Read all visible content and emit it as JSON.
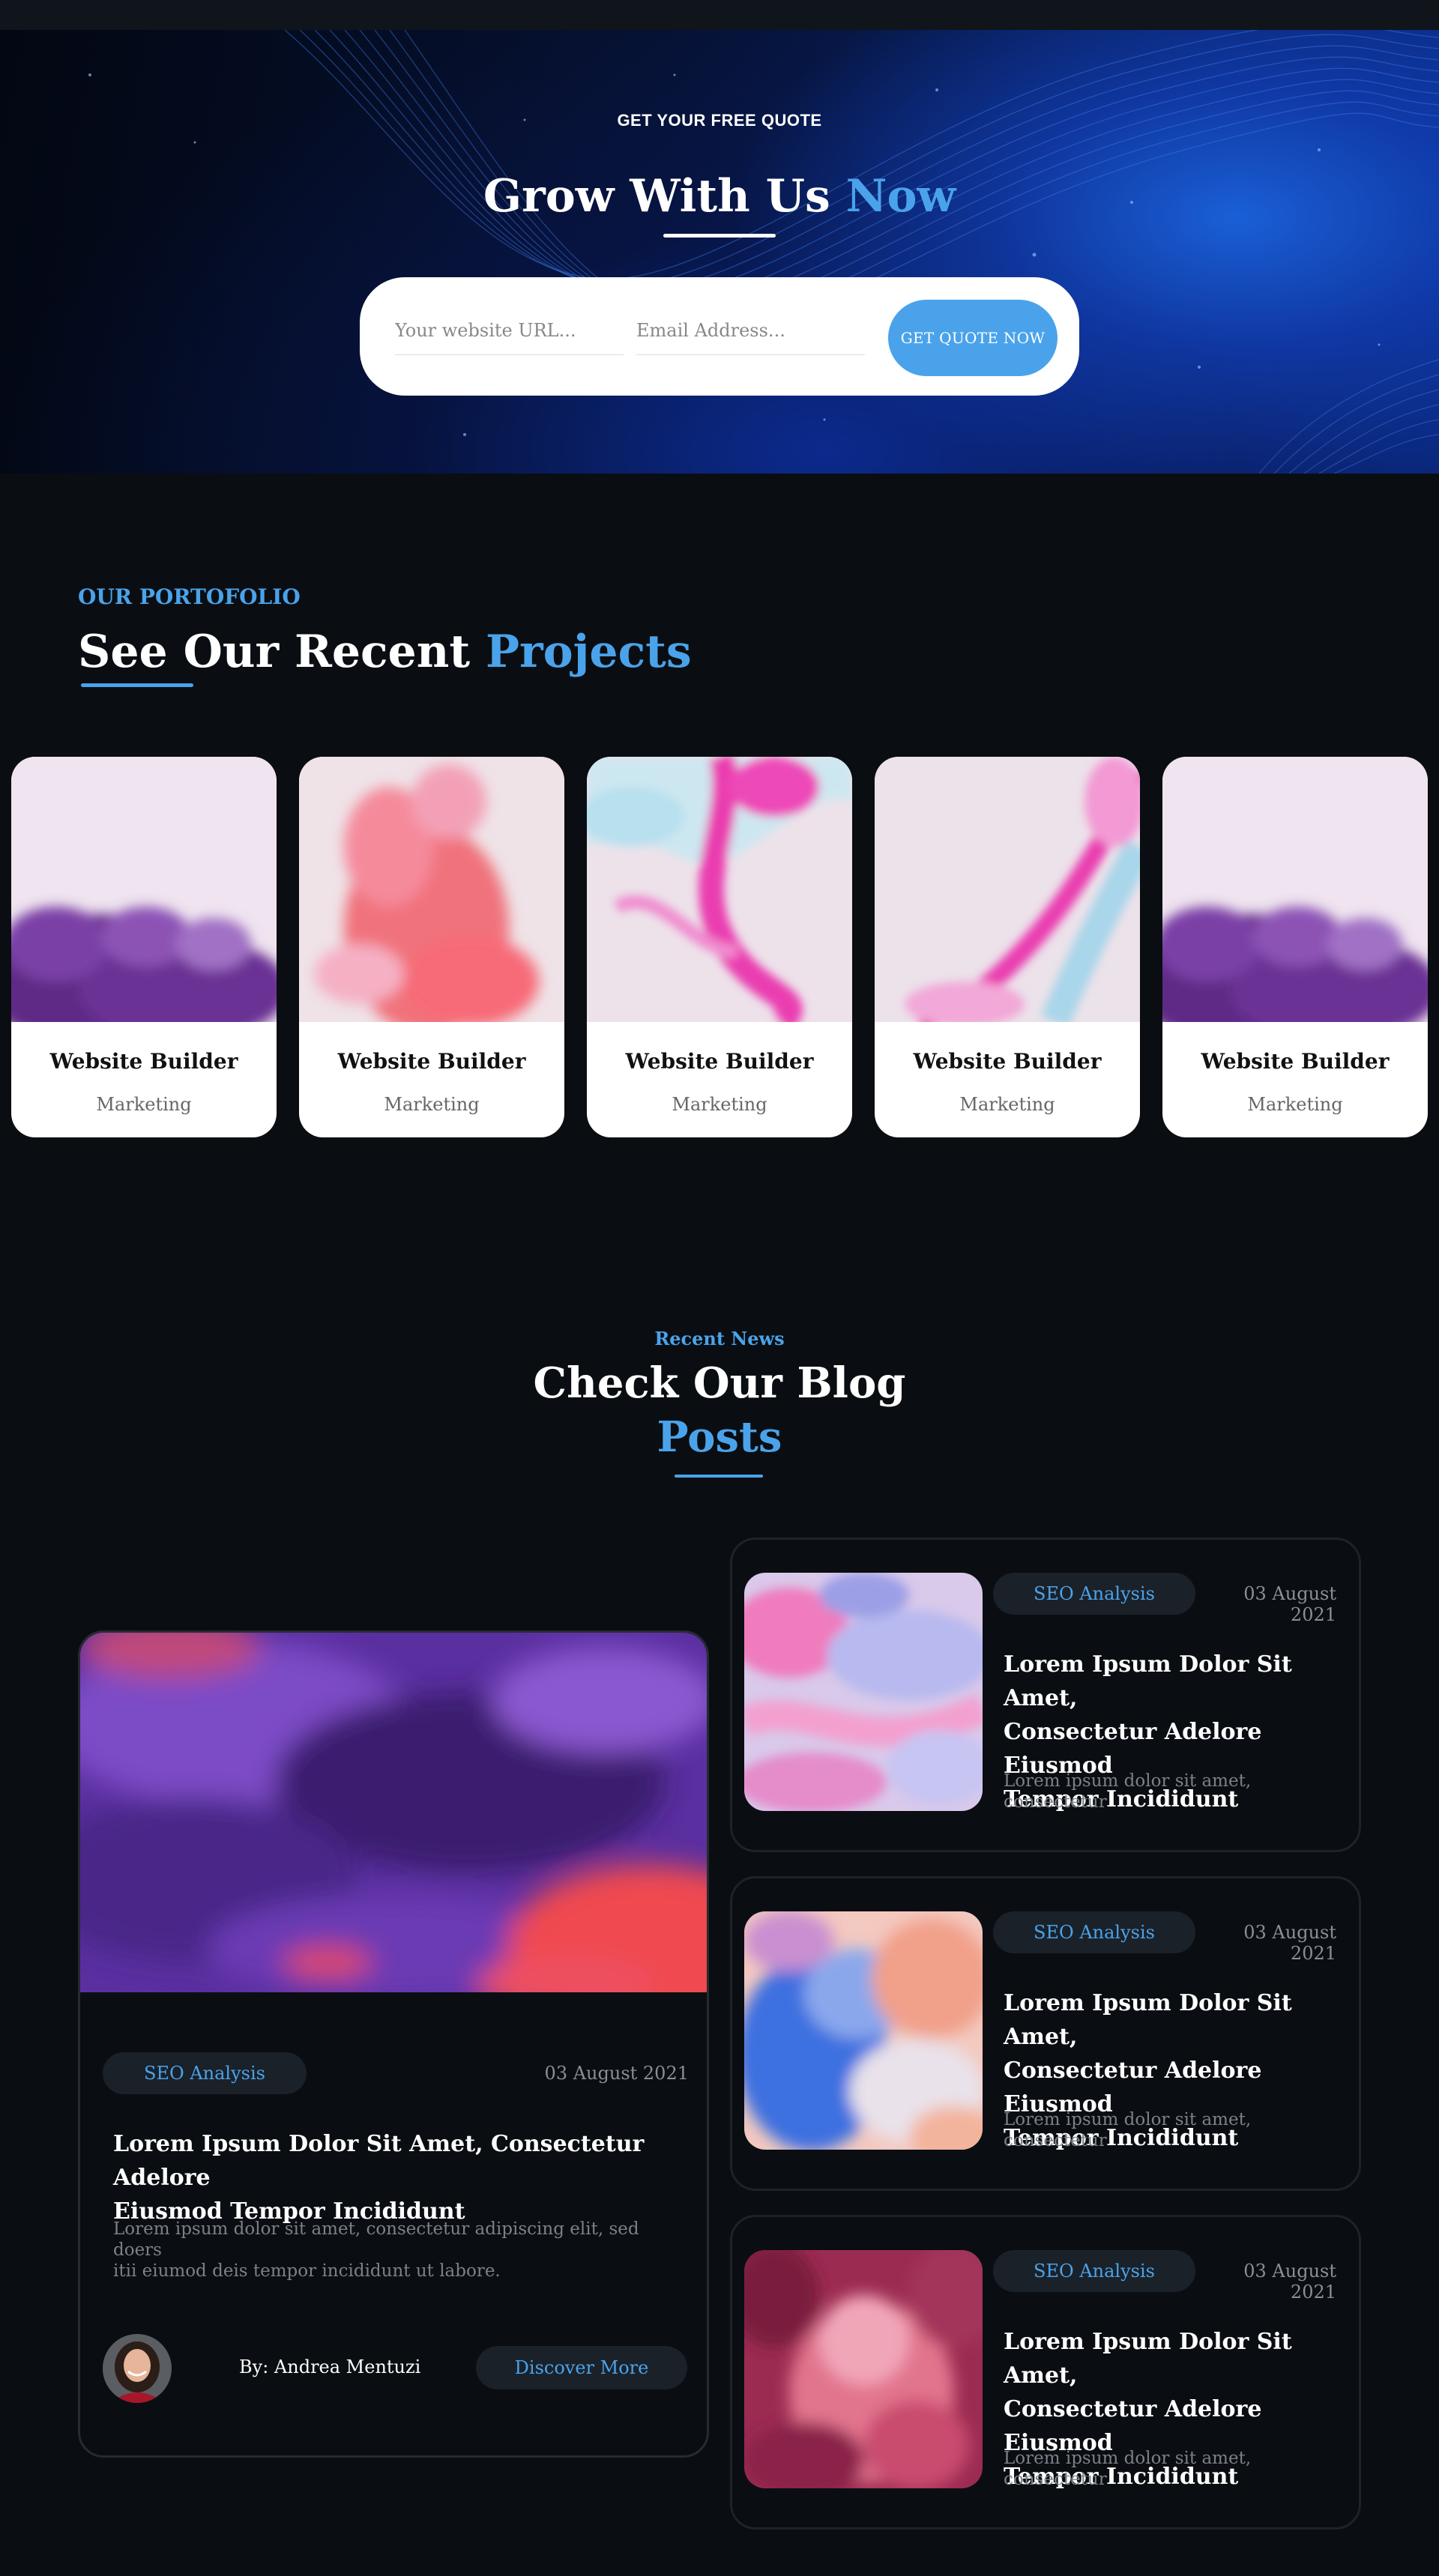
{
  "hero": {
    "eyebrow": "GET YOUR FREE QUOTE",
    "title_main": "Grow With Us ",
    "title_accent": "Now",
    "url_placeholder": "Your website URL...",
    "email_placeholder": "Email Address...",
    "button_label": "GET QUOTE NOW"
  },
  "portfolio": {
    "eyebrow": "OUR PORTOFOLIO",
    "title_main": "See Our Recent ",
    "title_accent": "Projects",
    "cards": [
      {
        "title": "Website Builder",
        "category": "Marketing",
        "art": "purple-ink"
      },
      {
        "title": "Website Builder",
        "category": "Marketing",
        "art": "pink-smoke"
      },
      {
        "title": "Website Builder",
        "category": "Marketing",
        "art": "pink-marble"
      },
      {
        "title": "Website Builder",
        "category": "Marketing",
        "art": "pink-marble-diagonal"
      },
      {
        "title": "Website Builder",
        "category": "Marketing",
        "art": "purple-ink"
      }
    ]
  },
  "blog": {
    "eyebrow": "Recent News",
    "title_line1": "Check Our Blog",
    "title_line2": "Posts",
    "featured": {
      "tag": "SEO Analysis",
      "date": "03 August 2021",
      "title_line1": "Lorem Ipsum Dolor Sit Amet, Consectetur Adelore",
      "title_line2": "Eiusmod Tempor Incididunt",
      "excerpt_line1": "Lorem ipsum dolor sit amet, consectetur adipiscing elit, sed doers",
      "excerpt_line2": "itii eiumod deis tempor incididunt ut labore.",
      "author": "By: Andrea Mentuzi",
      "button_label": "Discover More"
    },
    "posts": [
      {
        "tag": "SEO Analysis",
        "date": "03 August 2021",
        "title_line1": "Lorem Ipsum Dolor Sit Amet,",
        "title_line2": "Consectetur Adelore Eiusmod",
        "title_line3": "Tempor Incididunt",
        "excerpt_line1": "Lorem ipsum dolor sit amet,",
        "excerpt_line2": "consectetur",
        "art": "pink-marble"
      },
      {
        "tag": "SEO Analysis",
        "date": "03 August 2021",
        "title_line1": "Lorem Ipsum Dolor Sit Amet,",
        "title_line2": "Consectetur Adelore Eiusmod",
        "title_line3": "Tempor Incididunt",
        "excerpt_line1": "Lorem ipsum dolor sit amet,",
        "excerpt_line2": "consectetur",
        "art": "blue-orange-smoke"
      },
      {
        "tag": "SEO Analysis",
        "date": "03 August 2021",
        "title_line1": "Lorem Ipsum Dolor Sit Amet,",
        "title_line2": "Consectetur Adelore Eiusmod",
        "title_line3": "Tempor Incididunt",
        "excerpt_line1": "Lorem ipsum dolor sit amet,",
        "excerpt_line2": "consectetur",
        "art": "red-smoke"
      }
    ]
  },
  "colors": {
    "accent": "#4aa3ea",
    "background": "#0a0e12",
    "card": "#ffffff",
    "pill": "#1b2129"
  }
}
